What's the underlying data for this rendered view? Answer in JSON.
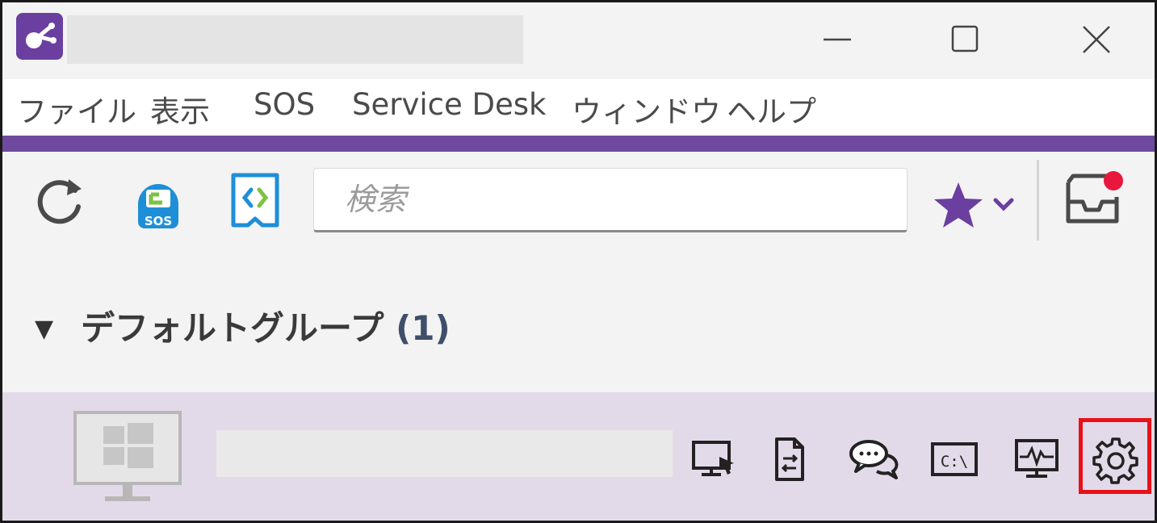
{
  "menu": {
    "items": [
      {
        "id": "file",
        "label": "ファイル"
      },
      {
        "id": "view",
        "label": "表示"
      },
      {
        "id": "sos",
        "label": "SOS"
      },
      {
        "id": "service_desk",
        "label": "Service Desk"
      },
      {
        "id": "window",
        "label": "ウィンドウ"
      },
      {
        "id": "help",
        "label": "ヘルプ"
      }
    ]
  },
  "toolbar": {
    "search_placeholder": "検索",
    "sos_badge_text": "SOS"
  },
  "group": {
    "toggle": "▼",
    "name": "デフォルトグループ",
    "count": "(1)"
  },
  "device": {
    "action_icons": [
      "remote-control-icon",
      "file-transfer-icon",
      "chat-icon",
      "command-prompt-icon",
      "system-monitor-icon",
      "settings-gear-icon"
    ],
    "cmd_text": "C:\\"
  },
  "colors": {
    "accent": "#6e4a9e",
    "logo_bg": "#6b3fa0",
    "star": "#6b3fa0",
    "sos_blue": "#1e8fd6",
    "sos_green": "#7cc242",
    "notification": "#e8173c",
    "device_row_bg": "#e3dae9",
    "highlight": "#e8101a"
  }
}
